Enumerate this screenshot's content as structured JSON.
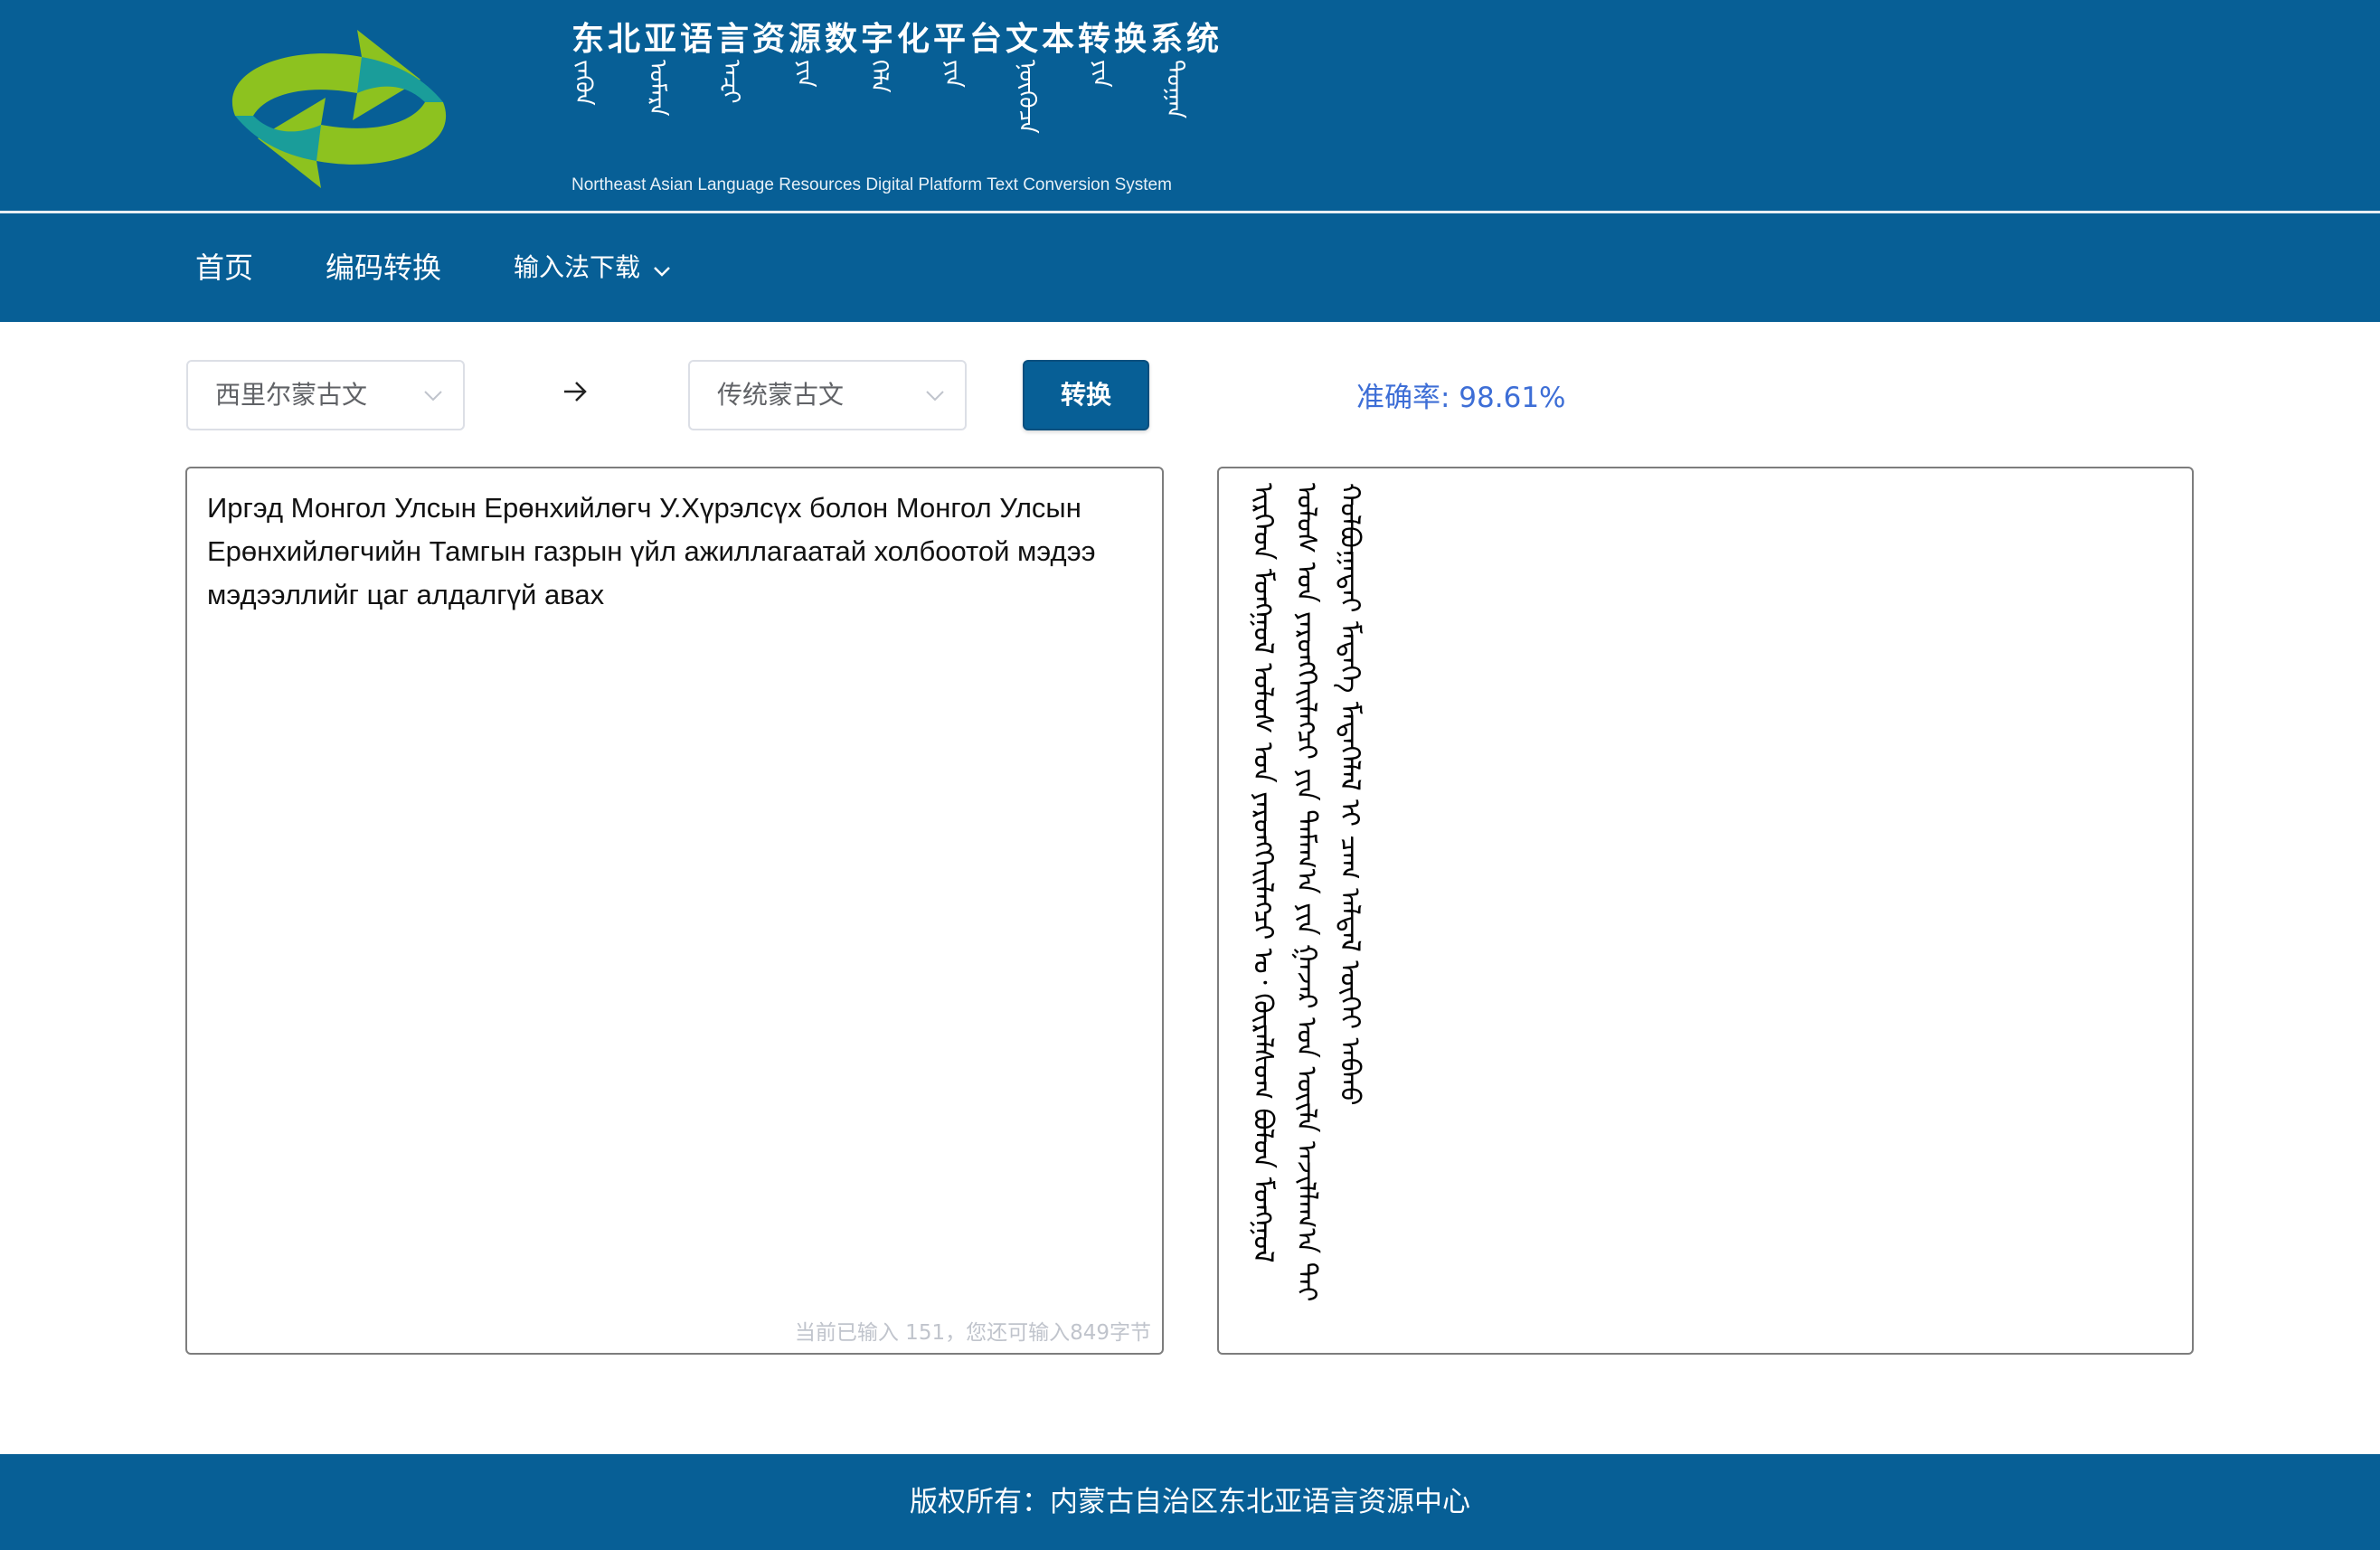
{
  "colors": {
    "brand_blue": "#075f96",
    "logo_green": "#8dc21f",
    "logo_teal": "#1a9d9a",
    "accuracy_blue": "#3d6ed6"
  },
  "header": {
    "logo_icon": "recycle-arrows-logo",
    "title_cn": "东北亚语言资源数字化平台文本转换系统",
    "title_mongolian_words": [
      "ᠵᠡᠭᠦᠨ",
      "ᠤᠮᠠᠷᠠ",
      "ᠠᠽᠢ",
      "ᠶᠢᠨ",
      "ᠬᠡᠯᠡ",
      "ᠶᠢᠨ",
      "ᠨᠦᠭᠦᠴᠡ",
      "ᠶᠢᠨ",
      "ᠲᠣᠭᠠᠨ"
    ],
    "title_en": "Northeast Asian Language Resources Digital Platform Text Conversion System"
  },
  "nav": {
    "home": "首页",
    "encode": "编码转换",
    "ime_download": "输入法下载"
  },
  "converter": {
    "source_lang": "西里尔蒙古文",
    "target_lang": "传统蒙古文",
    "convert_label": "转换",
    "accuracy": "准确率: 98.61%",
    "input_text": "Иргэд Монгол Улсын Ерөнхийлөгч У.Хүрэлсүх болон Монгол Улсын Ерөнхийлөгчийн Тамгын газрын үйл ажиллагаатай холбоотой мэдээ мэдээллийг цаг алдалгүй авах",
    "counter": "当前已输入 151，您还可输入849字节",
    "output_text": "ᠢᠷᠭᠡᠳ ᠮᠣᠩᠭᠣᠯ ᠤᠯᠤᠰ ᠤᠨ ᠶᠡᠷᠦᠩᠬᠡᠢᠯᠡᠭᠴᠢ ᠤ᠂ ᠬᠦᠷᠡᠯᠰᠦᠬ ᠪᠣᠯᠤᠨ ᠮᠣᠩᠭᠣᠯ ᠤᠯᠤᠰ ᠤᠨ ᠶᠡᠷᠦᠩᠬᠡᠢᠯᠡᠭᠴᠢ ᠶᠢᠨ ᠲᠠᠮᠠᠭ᠎ᠠ ᠶᠢᠨ ᠭᠠᠵᠠᠷ ᠤᠨ ᠦᠢᠯᠡ ᠠᠵᠢᠯᠯᠠᠭ᠎ᠠ ᠲᠠᠢ ᠬᠣᠯᠪᠣᠭᠠᠲᠠᠢ ᠮᠡᠳᠡᠭᠡ ᠮᠡᠳᠡᠭᠡᠯᠡᠯ ᠢ ᠴᠠᠭ ᠠᠯᠳᠠᠯ ᠦᠭᠡᠢ ᠠᠪᠬᠤ"
  },
  "footer": {
    "copyright": "版权所有：内蒙古自治区东北亚语言资源中心"
  }
}
